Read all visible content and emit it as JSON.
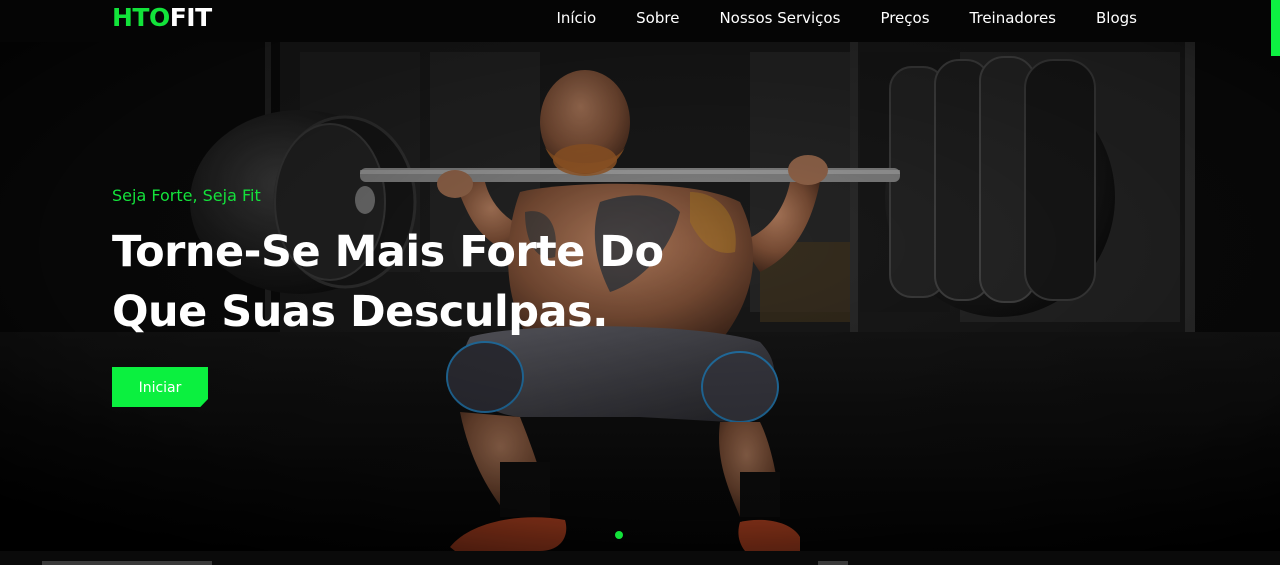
{
  "brand": {
    "logo_part1": "HTO",
    "logo_part2": "FIT",
    "accent_color": "#12e33a"
  },
  "nav": {
    "items": [
      {
        "label": "Início"
      },
      {
        "label": "Sobre"
      },
      {
        "label": "Nossos Serviços"
      },
      {
        "label": "Preços"
      },
      {
        "label": "Treinadores"
      },
      {
        "label": "Blogs"
      }
    ]
  },
  "hero": {
    "tagline": "Seja Forte, Seja Fit",
    "headline_line1": "Torne-Se Mais Forte Do",
    "headline_line2": "Que Suas Desculpas.",
    "cta_label": "Iniciar",
    "image_subject": "weightlifter-squat-barbell-photo",
    "slider_active_index": 0
  }
}
